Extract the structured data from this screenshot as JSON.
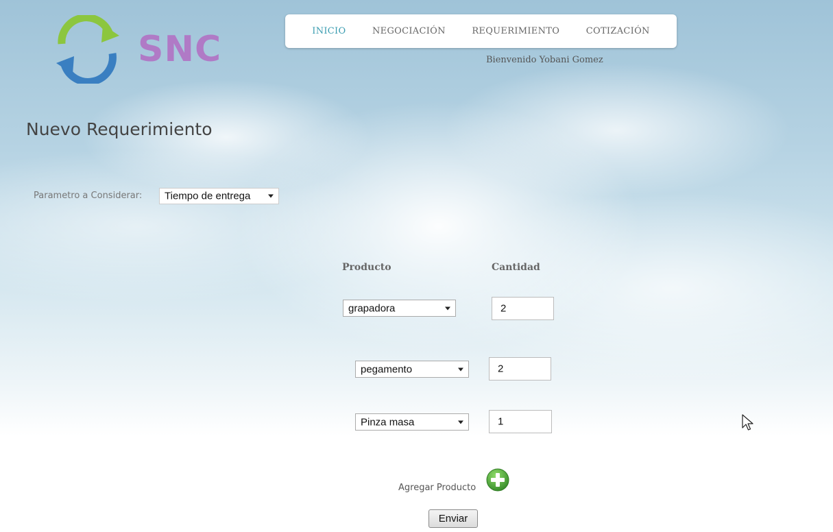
{
  "logo": {
    "text": "SNC"
  },
  "nav": {
    "items": [
      {
        "label": "INICIO",
        "active": true
      },
      {
        "label": "NEGOCIACIÓN"
      },
      {
        "label": "REQUERIMIENTO"
      },
      {
        "label": "COTIZACIÓN"
      }
    ]
  },
  "welcome": "Bienvenido Yobani Gomez",
  "page_title": "Nuevo Requerimiento",
  "parameter": {
    "label": "Parametro a Considerar:",
    "selected": "Tiempo de entrega"
  },
  "table": {
    "headers": {
      "product": "Producto",
      "quantity": "Cantidad"
    },
    "rows": [
      {
        "product": "grapadora",
        "quantity": "2"
      },
      {
        "product": "pegamento",
        "quantity": "2"
      },
      {
        "product": "Pinza masa",
        "quantity": "1"
      }
    ]
  },
  "add_product": {
    "label": "Agregar Producto",
    "icon": "plus-circle-icon"
  },
  "submit_label": "Enviar",
  "colors": {
    "nav_active": "#3a9cb0",
    "logo_text": "#b07ac6",
    "logo_green": "#8cc63f",
    "logo_blue": "#3a7fc1",
    "add_icon_green": "#4aa83a"
  }
}
